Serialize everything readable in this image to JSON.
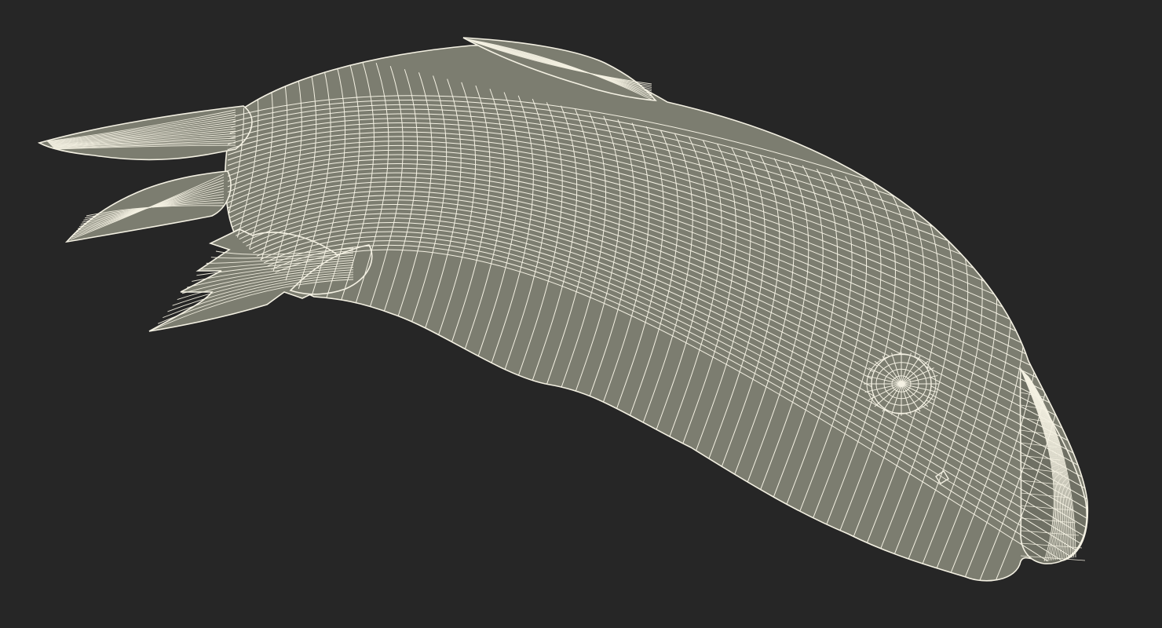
{
  "scene": {
    "subject_icon": "fish-wireframe-icon",
    "render_style": "wireframe",
    "colors": {
      "background": "#262626",
      "surface": "#7c7d70",
      "surface_shadow": "#6f7064",
      "wire": "#f4f1e3"
    }
  }
}
